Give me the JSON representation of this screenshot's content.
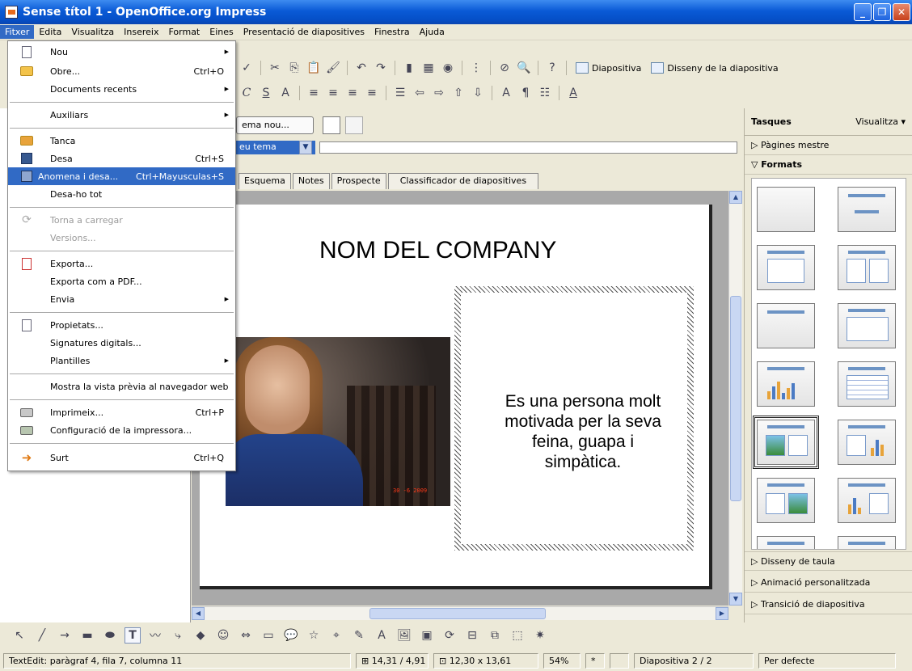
{
  "window": {
    "title": "Sense títol 1 - OpenOffice.org Impress"
  },
  "menubar": [
    "Fitxer",
    "Edita",
    "Visualitza",
    "Insereix",
    "Format",
    "Eines",
    "Presentació de diapositives",
    "Finestra",
    "Ajuda"
  ],
  "toolbar": {
    "slide_btn": "Diapositiva",
    "layout_btn": "Disseny de la diapositiva"
  },
  "editor": {
    "theme_new": "ema nou...",
    "theme_select": "eu tema"
  },
  "view_tabs": [
    "Esquema",
    "Notes",
    "Prospecte",
    "Classificador de diapositives"
  ],
  "slide": {
    "title": "NOM DEL COMPANY",
    "photo_date": "30 -6 2009",
    "text_lines": [
      "Es una persona molt",
      "motivada per la seva",
      "feina, guapa i",
      "simpàtica."
    ]
  },
  "tasks": {
    "title": "Tasques",
    "view": "Visualitza",
    "master_pages": "Pàgines mestre",
    "formats": "Formats",
    "table_design": "Disseny de taula",
    "custom_animation": "Animació personalitzada",
    "slide_transition": "Transició de diapositiva"
  },
  "file_menu": {
    "nou": "Nou",
    "obre": "Obre...",
    "obre_sc": "Ctrl+O",
    "recents": "Documents recents",
    "auxiliars": "Auxiliars",
    "tanca": "Tanca",
    "desa": "Desa",
    "desa_sc": "Ctrl+S",
    "anomena": "Anomena i desa...",
    "anomena_sc": "Ctrl+Mayusculas+S",
    "desatot": "Desa-ho tot",
    "recarrega": "Torna a carregar",
    "versions": "Versions...",
    "exporta": "Exporta...",
    "pdf": "Exporta com a PDF...",
    "envia": "Envia",
    "propietats": "Propietats...",
    "signatures": "Signatures digitals...",
    "plantilles": "Plantilles",
    "vista_web": "Mostra la vista prèvia al navegador web",
    "imprimeix": "Imprimeix...",
    "imprimeix_sc": "Ctrl+P",
    "config_print": "Configuració de la impressora...",
    "surt": "Surt",
    "surt_sc": "Ctrl+Q"
  },
  "status": {
    "textedit": "TextEdit: paràgraf 4, fila 7, columna 11",
    "pos": "14,31 / 4,91",
    "size": "12,30 x 13,61",
    "zoom": "54%",
    "modified": "*",
    "slide": "Diapositiva 2 / 2",
    "style": "Per defecte"
  },
  "colors": {
    "accent": "#316ac5",
    "title_bar": "#0a5ad6",
    "face": "#ece9d8"
  }
}
